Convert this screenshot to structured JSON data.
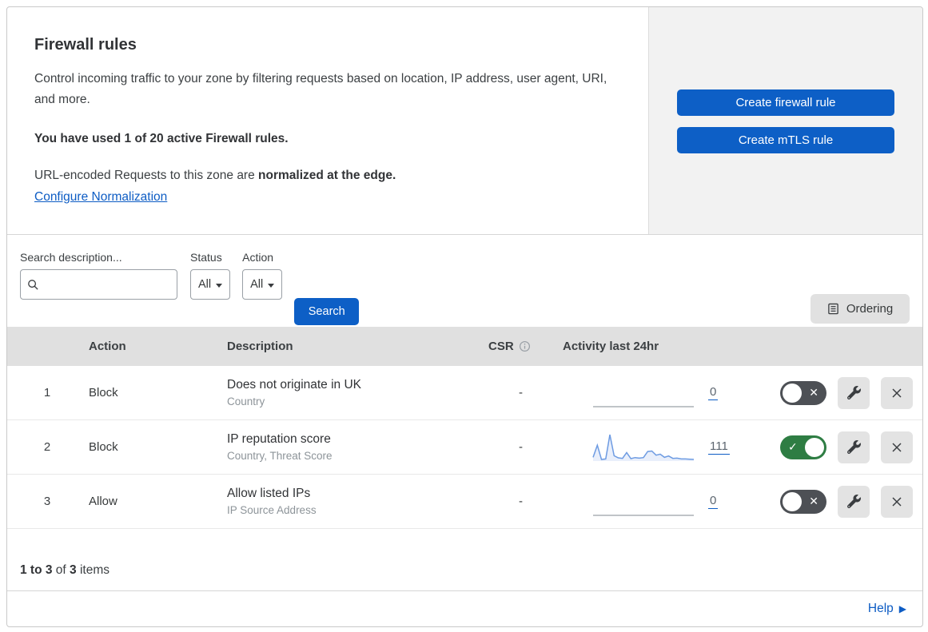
{
  "page": {
    "title": "Firewall rules",
    "description": "Control incoming traffic to your zone by filtering requests based on location, IP address, user agent, URI, and more.",
    "usage_text": "You have used 1 of 20 active Firewall rules.",
    "normalization_text": "URL-encoded Requests to this zone are ",
    "normalization_bold": "normalized at the edge.",
    "normalization_link": "Configure Normalization",
    "create_firewall_button": "Create firewall rule",
    "create_mtls_button": "Create mTLS rule"
  },
  "filters": {
    "search_label": "Search description...",
    "search_placeholder": "",
    "search_value": "",
    "status_label": "Status",
    "status_value": "All",
    "action_label": "Action",
    "action_value": "All",
    "search_button": "Search",
    "ordering_button": "Ordering"
  },
  "table": {
    "headers": {
      "action": "Action",
      "description": "Description",
      "csr": "CSR",
      "activity": "Activity last 24hr"
    },
    "rows": [
      {
        "number": "1",
        "action": "Block",
        "description": "Does not originate in UK",
        "criteria": "Country",
        "csr": "-",
        "activity_count": "0",
        "enabled": false,
        "sparkline": []
      },
      {
        "number": "2",
        "action": "Block",
        "description": "IP reputation score",
        "criteria": "Country, Threat Score",
        "csr": "-",
        "activity_count": "111",
        "enabled": true,
        "sparkline": [
          14,
          60,
          6,
          8,
          100,
          20,
          12,
          10,
          32,
          9,
          13,
          11,
          13,
          36,
          38,
          22,
          26,
          14,
          19,
          10,
          11,
          8,
          8,
          7,
          6
        ]
      },
      {
        "number": "3",
        "action": "Allow",
        "description": "Allow listed IPs",
        "criteria": "IP Source Address",
        "csr": "-",
        "activity_count": "0",
        "enabled": false,
        "sparkline": []
      }
    ]
  },
  "footer": {
    "range": "1 to 3",
    "of_text": " of ",
    "total": "3",
    "items_text": " items",
    "help_label": "Help"
  },
  "icons": {
    "toggle_on": "✓",
    "toggle_off": "✕"
  },
  "colors": {
    "primary_blue": "#0d5fc6",
    "link_blue": "#0d5cc4",
    "toggle_on_green": "#2e7d43",
    "toggle_off_gray": "#4d5055",
    "sparkline_blue": "#6d9be2",
    "sparkline_fill": "#e9effb",
    "flat_line_gray": "#9aa0a6",
    "panel_gray": "#f2f2f2",
    "table_header_gray": "#e0e0e0"
  }
}
